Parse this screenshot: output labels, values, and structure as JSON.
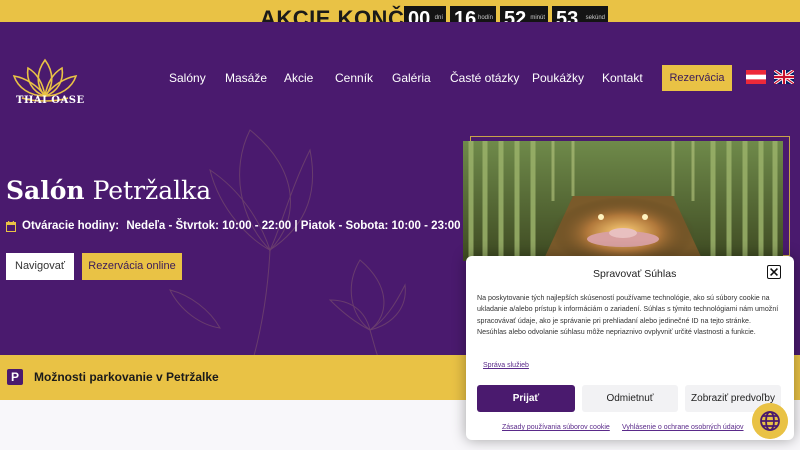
{
  "promo": {
    "text": "AKCIE KONČIA",
    "countdown": [
      {
        "value": "00",
        "unit": "dní"
      },
      {
        "value": "16",
        "unit": "hodín"
      },
      {
        "value": "52",
        "unit": "minút"
      },
      {
        "value": "53",
        "unit": "sekúnd"
      }
    ]
  },
  "header": {
    "logo_text": "THAI OASE",
    "nav": [
      "Salóny",
      "Masáže",
      "Akcie",
      "Cenník",
      "Galéria",
      "Časté otázky",
      "Poukážky",
      "Kontakt"
    ],
    "reserve_label": "Rezervácia",
    "languages": [
      "austria-flag",
      "uk-flag"
    ]
  },
  "hero": {
    "title_bold": "Salón",
    "title_rest": "Petržalka",
    "hours_label": "Otváracie hodiny:",
    "hours_value": "Nedeľa - Štvrtok: 10:00 - 22:00 | Piatok - Sobota: 10:00 - 23:00",
    "navigate_label": "Navigovať",
    "reserve_online_label": "Rezervácia online"
  },
  "parking": {
    "icon_letter": "P",
    "label": "Možnosti parkovanie v Petržalke"
  },
  "consent": {
    "title": "Spravovať Súhlas",
    "body": "Na poskytovanie tých najlepších skúseností používame technológie, ako sú súbory cookie na ukladanie a/alebo prístup k informáciám o zariadení. Súhlas s týmito technológiami nám umožní spracovávať údaje, ako je správanie pri prehliadaní alebo jedinečné ID na tejto stránke. Nesúhlas alebo odvolanie súhlasu môže nepriaznivo ovplyvniť určité vlastnosti a funkcie.",
    "manage_link": "Správa služieb",
    "accept_label": "Prijať",
    "deny_label": "Odmietnuť",
    "prefs_label": "Zobraziť predvoľby",
    "cookie_policy": "Zásady používania súborov cookie",
    "privacy_policy": "Vyhlásenie o ochrane osobných údajov"
  },
  "colors": {
    "purple": "#4a1a6e",
    "gold": "#e9c245"
  }
}
